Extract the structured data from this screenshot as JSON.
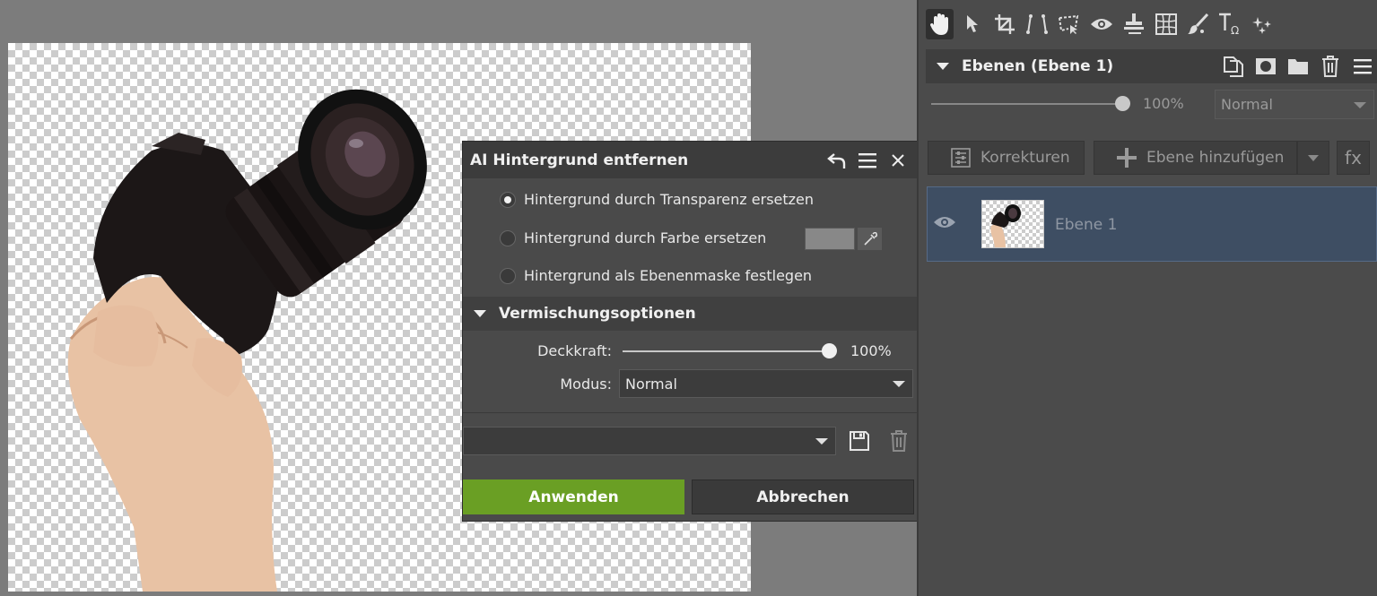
{
  "dialog": {
    "title": "AI Hintergrund entfernen",
    "options": [
      {
        "label": "Hintergrund durch Transparenz ersetzen",
        "selected": true
      },
      {
        "label": "Hintergrund durch Farbe ersetzen",
        "selected": false
      },
      {
        "label": "Hintergrund als Ebenenmaske festlegen",
        "selected": false
      }
    ],
    "replace_color": "#888888",
    "blend_section_title": "Vermischungsoptionen",
    "opacity_label": "Deckkraft:",
    "opacity_value": "100%",
    "opacity_fraction": 1.0,
    "mode_label": "Modus:",
    "mode_value": "Normal",
    "preset_value": "",
    "apply_label": "Anwenden",
    "cancel_label": "Abbrechen",
    "apply_color": "#6a9f24"
  },
  "panel": {
    "tools": [
      "hand-icon",
      "pointer-icon",
      "crop-icon",
      "transform-icon",
      "selection-icon",
      "eye-icon",
      "stamp-icon",
      "grid-icon",
      "brush-icon",
      "text-icon",
      "effects-icon"
    ],
    "layers_title": "Ebenen (Ebene 1)",
    "opacity_value": "100%",
    "blend_mode": "Normal",
    "corrections_label": "Korrekturen",
    "add_layer_label": "Ebene hinzufügen",
    "fx_label": "fx",
    "layer_name": "Ebene 1",
    "selected_row_color": "#3e4e63"
  }
}
